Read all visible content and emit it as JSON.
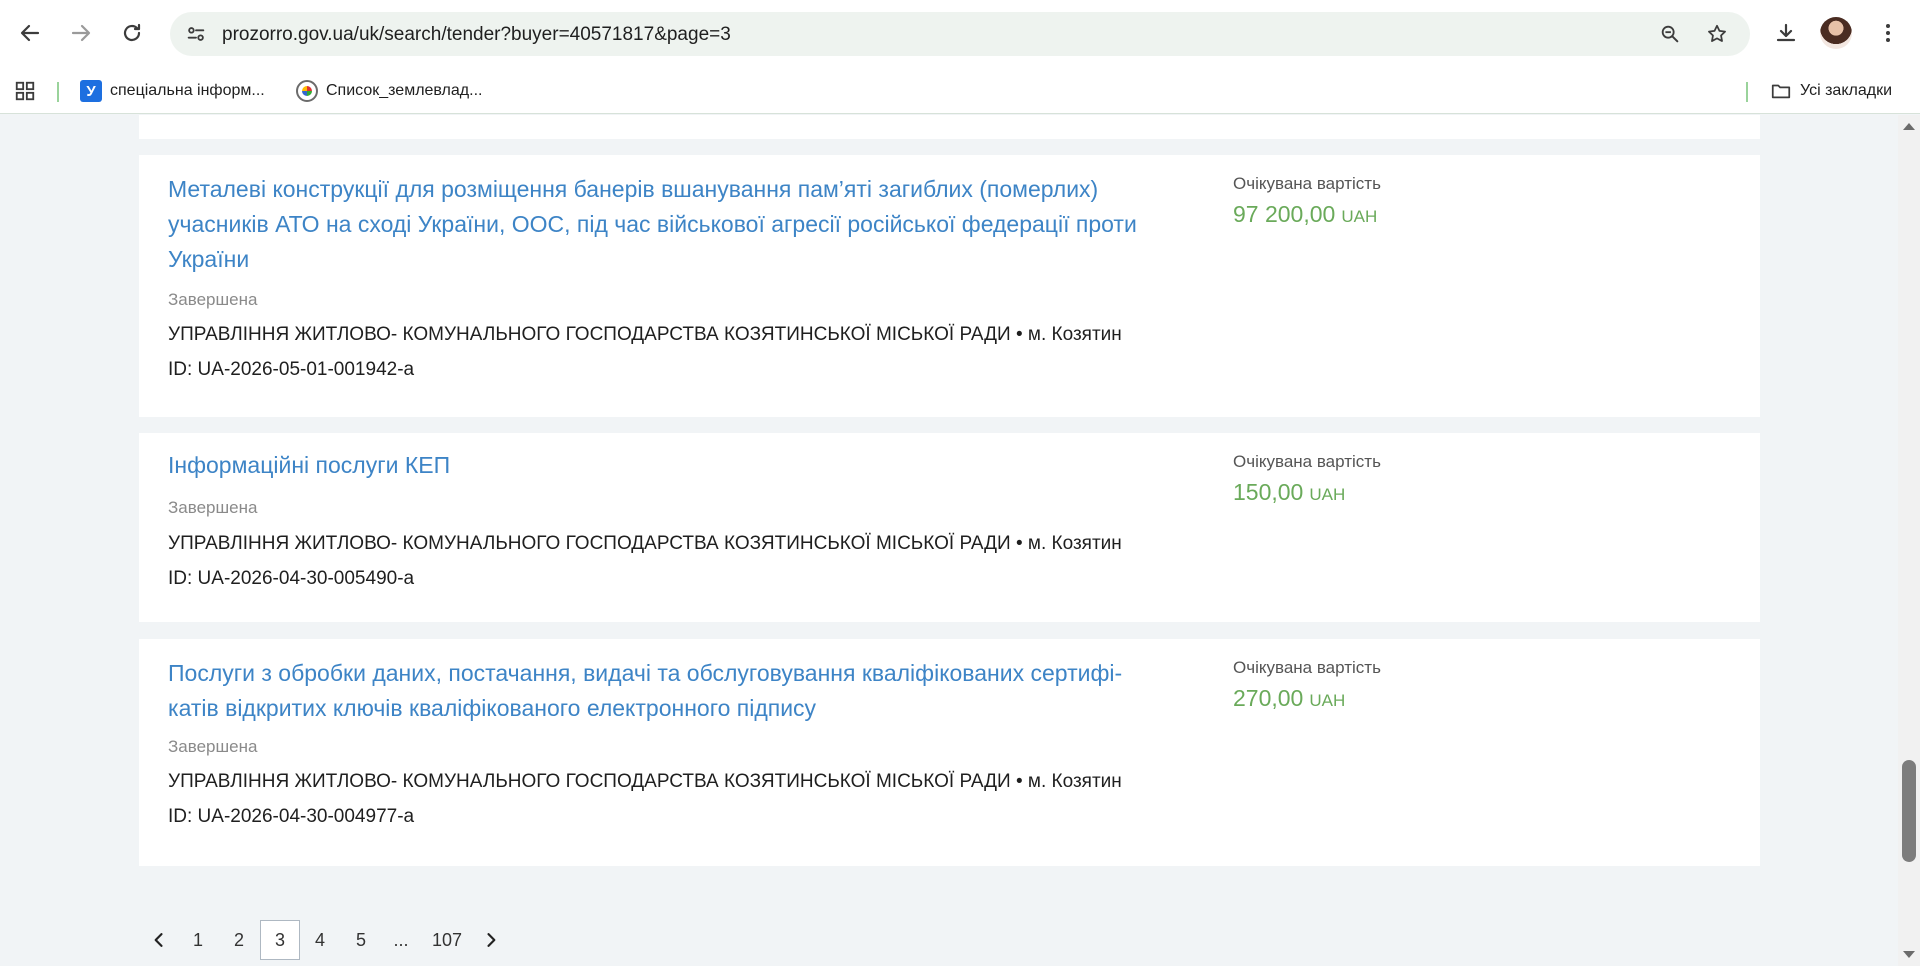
{
  "browser": {
    "url": "prozorro.gov.ua/uk/search/tender?buyer=40571817&page=3",
    "bookmarks": [
      {
        "label": "спеціальна інформ...",
        "icon": "u-favicon"
      },
      {
        "label": "Список_землевлад...",
        "icon": "wikipedia-favicon"
      }
    ],
    "all_bookmarks_label": "Усі закладки"
  },
  "tenders": [
    {
      "title_lines": [
        "Металеві конструкції для розміщення банерів вшанування пам’яті загиблих (померлих)",
        "учасників АТО на сході України, ООС, під час військової агресії російської федерації проти",
        "України"
      ],
      "status": "Завершена",
      "buyer": "УПРАВЛІННЯ ЖИТЛОВО- КОМУНАЛЬНОГО ГОСПОДАРСТВА КОЗЯТИНСЬКОЇ МІСЬКОЇ РАДИ • м. Козятин",
      "id": "ID: UA-2026-05-01-001942-a",
      "value_label": "Очікувана вартість",
      "amount": "97 200,00",
      "currency": "UAH"
    },
    {
      "title_lines": [
        "Інформаційні послуги КЕП"
      ],
      "status": "Завершена",
      "buyer": "УПРАВЛІННЯ ЖИТЛОВО- КОМУНАЛЬНОГО ГОСПОДАРСТВА КОЗЯТИНСЬКОЇ МІСЬКОЇ РАДИ • м. Козятин",
      "id": "ID: UA-2026-04-30-005490-a",
      "value_label": "Очікувана вартість",
      "amount": "150,00",
      "currency": "UAH"
    },
    {
      "title_lines": [
        "Послуги з обробки даних, постачання, видачі та обслуговування кваліфікованих сертифі-",
        "катів відкритих ключів кваліфікованого електронного підпису"
      ],
      "status": "Завершена",
      "buyer": "УПРАВЛІННЯ ЖИТЛОВО- КОМУНАЛЬНОГО ГОСПОДАРСТВА КОЗЯТИНСЬКОЇ МІСЬКОЇ РАДИ • м. Козятин",
      "id": "ID: UA-2026-04-30-004977-a",
      "value_label": "Очікувана вартість",
      "amount": "270,00",
      "currency": "UAH"
    }
  ],
  "pagination": {
    "pages": [
      "1",
      "2",
      "3",
      "4",
      "5",
      "...",
      "107"
    ],
    "current": "3"
  }
}
